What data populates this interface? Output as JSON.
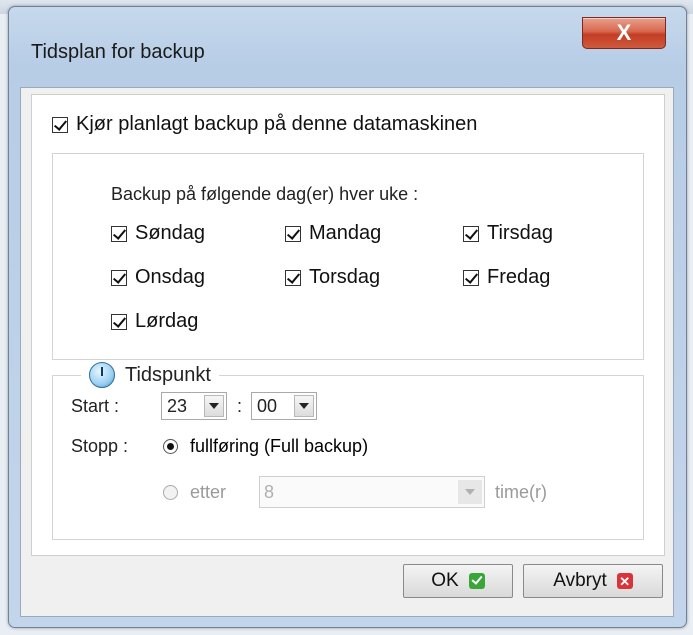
{
  "window": {
    "title": "Tidsplan for backup",
    "close_glyph": "X"
  },
  "schedule": {
    "enable_label": "Kjør planlagt backup på denne datamaskinen",
    "enable_checked": true
  },
  "days": {
    "heading": "Backup på følgende dag(er) hver uke :",
    "items": [
      {
        "label": "Søndag",
        "checked": true
      },
      {
        "label": "Mandag",
        "checked": true
      },
      {
        "label": "Tirsdag",
        "checked": true
      },
      {
        "label": "Onsdag",
        "checked": true
      },
      {
        "label": "Torsdag",
        "checked": true
      },
      {
        "label": "Fredag",
        "checked": true
      },
      {
        "label": "Lørdag",
        "checked": true
      }
    ]
  },
  "time": {
    "section_label": "Tidspunkt",
    "start_label": "Start :",
    "hour": "23",
    "separator": ":",
    "minute": "00",
    "stop_label": "Stopp :",
    "option_full": "fullføring (Full backup)",
    "option_after": "etter",
    "after_value": "8",
    "after_unit": "time(r)",
    "selected_option": "full"
  },
  "buttons": {
    "ok_label": "OK",
    "cancel_label": "Avbryt"
  },
  "colors": {
    "ok_icon": "#3aa63a",
    "cancel_icon": "#d8343a",
    "close_button": "#c33d24"
  }
}
